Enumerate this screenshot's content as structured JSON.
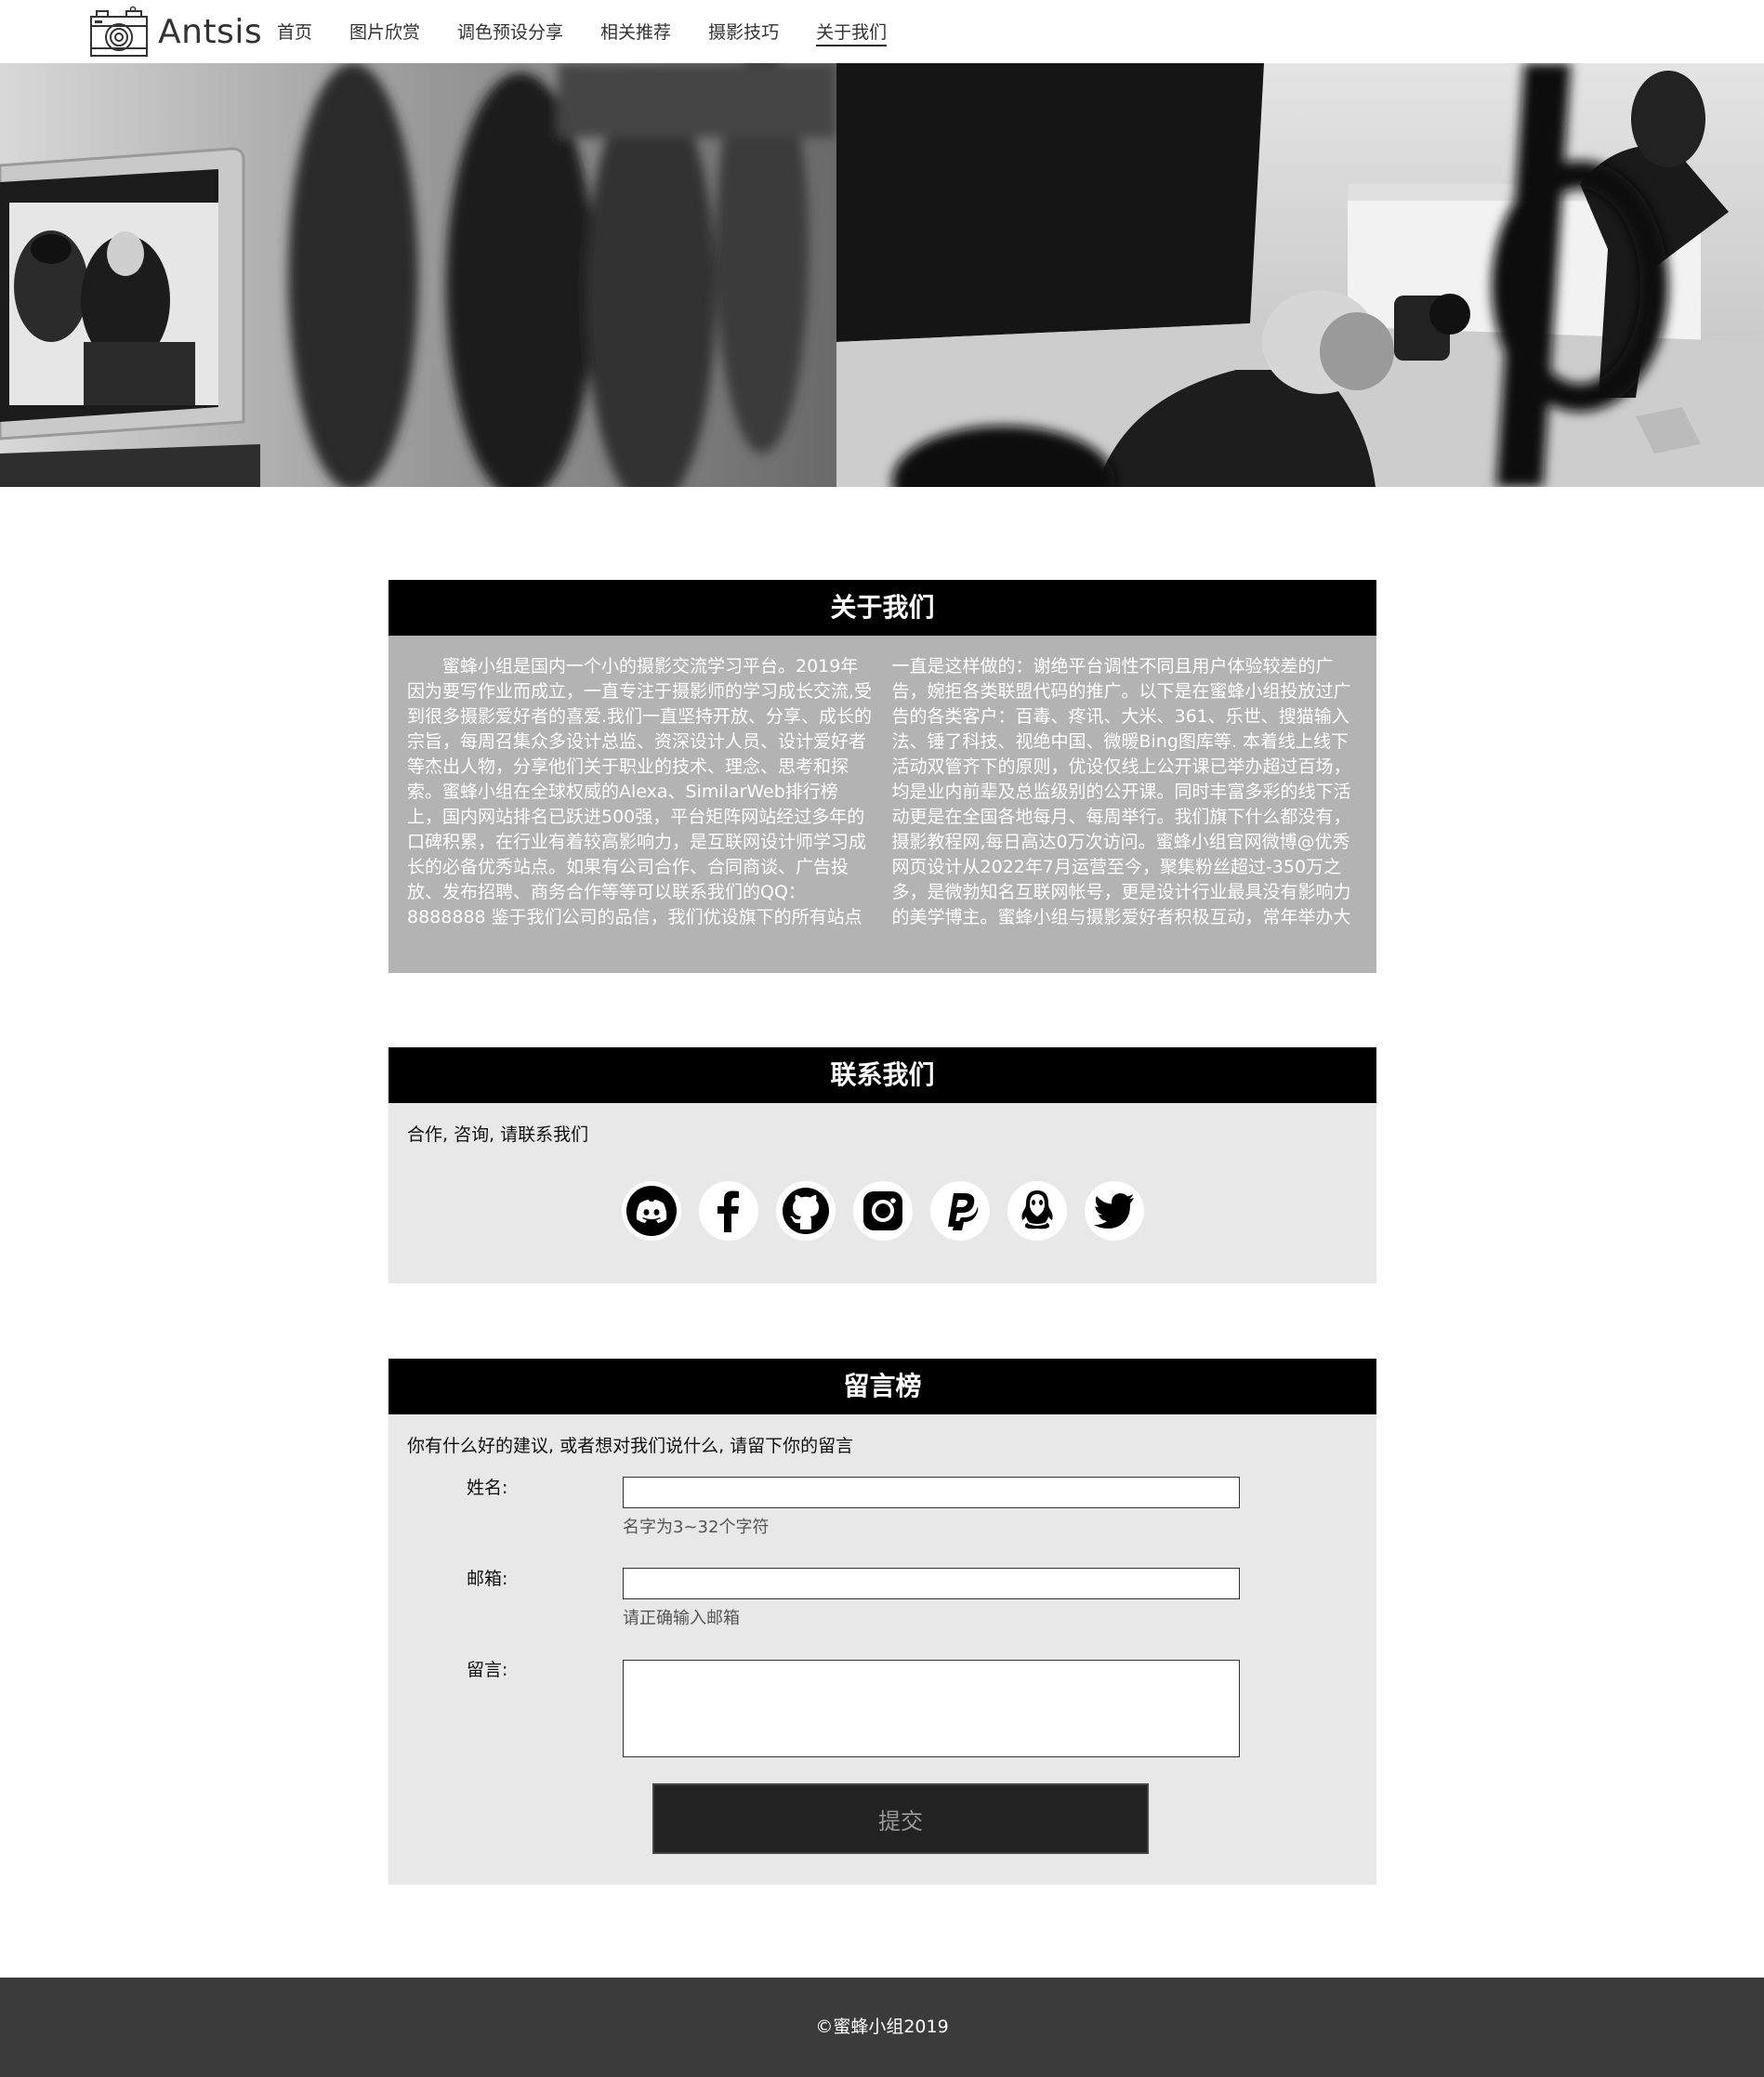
{
  "brand": {
    "name": "Antsis",
    "logo_icon": "camera-icon"
  },
  "nav": {
    "items": [
      {
        "label": "首页"
      },
      {
        "label": "图片欣赏"
      },
      {
        "label": "调色预设分享"
      },
      {
        "label": "相关推荐"
      },
      {
        "label": "摄影技巧"
      },
      {
        "label": "关于我们"
      }
    ],
    "active": "关于我们"
  },
  "about": {
    "title": "关于我们",
    "text": "蜜蜂小组是国内一个小的摄影交流学习平台。2019年因为要写作业而成立，一直专注于摄影师的学习成长交流,受到很多摄影爱好者的喜爱.我们一直坚持开放、分享、成长的宗旨，每周召集众多设计总监、资深设计人员、设计爱好者等杰出人物，分享他们关于职业的技术、理念、思考和探索。蜜蜂小组在全球权威的Alexa、SimilarWeb排行榜上，国内网站排名已跃进500强，平台矩阵网站经过多年的口碑积累，在行业有着较高影响力，是互联网设计师学习成长的必备优秀站点。如果有公司合作、合同商谈、广告投放、发布招聘、商务合作等等可以联系我们的QQ：8888888 鉴于我们公司的品信，我们优设旗下的所有站点一直是这样做的：谢绝平台调性不同且用户体验较差的广告，婉拒各类联盟代码的推广。以下是在蜜蜂小组投放过广告的各类客户：百毒、疼讯、大米、361、乐世、搜猫输入法、锤了科技、视绝中国、微暖Bing图库等. 本着线上线下活动双管齐下的原则，优设仅线上公开课已举办超过百场，均是业内前辈及总监级别的公开课。同时丰富多彩的线下活动更是在全国各地每月、每周举行。我们旗下什么都没有，摄影教程网,每日高达0万次访问。蜜蜂小组官网微博@优秀网页设计从2022年7月运营至今，聚集粉丝超过-350万之多，是微勃知名互联网帐号，更是设计行业最具没有影响力的美学博主。蜜蜂小组与摄影爱好者积极互动，常年举办大型摄影比赛、微影赛、摄影讲座、训练营、摄影展览等线上、线下活动。"
  },
  "contact": {
    "title": "联系我们",
    "intro": "合作, 咨询, 请联系我们",
    "socials": [
      {
        "icon": "discord-icon"
      },
      {
        "icon": "facebook-icon"
      },
      {
        "icon": "github-icon"
      },
      {
        "icon": "instagram-icon"
      },
      {
        "icon": "paypal-icon"
      },
      {
        "icon": "qq-icon"
      },
      {
        "icon": "twitter-icon"
      }
    ]
  },
  "guestbook": {
    "title": "留言榜",
    "intro": "你有什么好的建议, 或者想对我们说什么, 请留下你的留言",
    "name_label": "姓名:",
    "name_value": "",
    "name_hint": "名字为3~32个字符",
    "email_label": "邮箱:",
    "email_value": "",
    "email_hint": "请正确输入邮箱",
    "message_label": "留言:",
    "message_value": "",
    "submit_label": "提交"
  },
  "footer": {
    "text": "©蜜蜂小组2019"
  },
  "colors": {
    "title_bar": "#000000",
    "about_bg": "#b3b3b3",
    "panel_bg": "#e8e8e8",
    "footer_bg": "#3b3b3b",
    "button_bg": "#222222"
  }
}
